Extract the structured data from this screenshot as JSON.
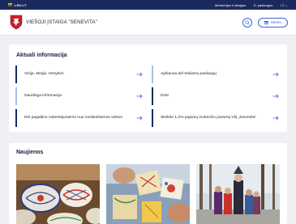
{
  "topbar": {
    "country": "LRV.LT",
    "links": [
      "Ministerijos ir įstaigos",
      "E. paslaugos",
      "LT"
    ]
  },
  "header": {
    "org_name": "VIEŠOJI ĮSTAIGA \"SENEVITA\"",
    "menu_label": "Meniu"
  },
  "info": {
    "title": "Aktuali informacija",
    "tiles": [
      {
        "label": "Vizija, Misija, Vertybės"
      },
      {
        "label": "Apklausa dėl teikiamų paslaugų"
      },
      {
        "label": "Naudinga informacija"
      },
      {
        "label": "DUK"
      },
      {
        "label": "Dėl pagalbos nukentėjusiems nuo nusikalstamos veikos"
      },
      {
        "label": "Skirkite 1,2% pajamų mokesčio paramą VšĮ „Senevita“"
      }
    ]
  },
  "news": {
    "title": "Naujienos"
  },
  "colors": {
    "topbar": "#1b2a5e",
    "accent": "#3a63d8",
    "tile_border_dark": "#1b2a5e",
    "tile_border_light": "#9ec2e8"
  }
}
